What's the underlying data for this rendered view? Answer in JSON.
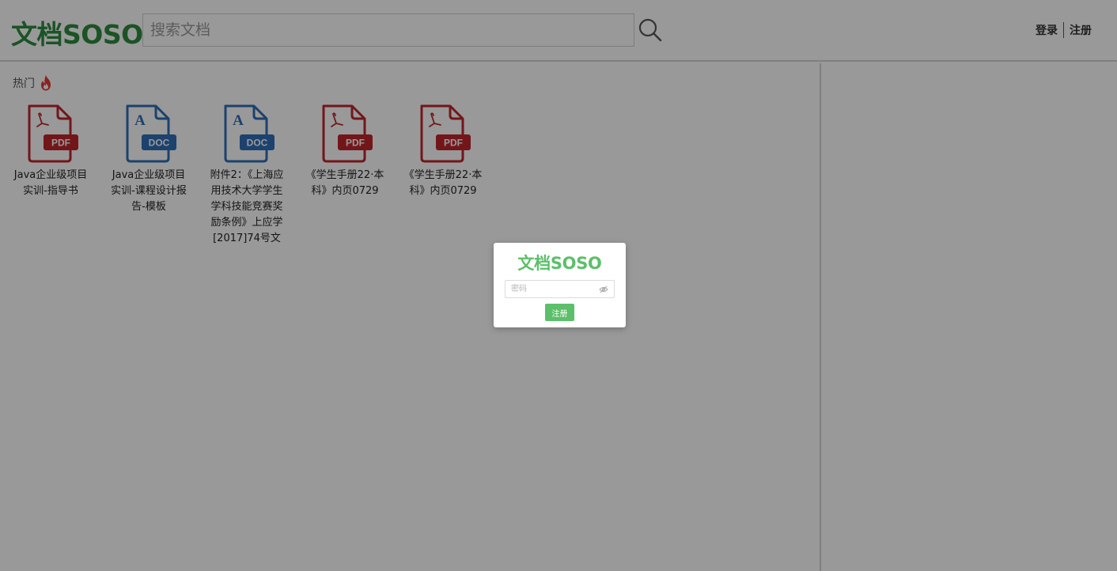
{
  "header": {
    "logo": "文档SOSO",
    "search_placeholder": "搜索文档",
    "login": "登录",
    "register": "注册"
  },
  "hot": {
    "label": "热门"
  },
  "documents": [
    {
      "type": "pdf",
      "badge": "PDF",
      "title": "Java企业级项目实训-指导书"
    },
    {
      "type": "doc",
      "badge": "DOC",
      "title": "Java企业级项目实训-课程设计报告-模板"
    },
    {
      "type": "doc",
      "badge": "DOC",
      "title": "附件2：《上海应用技术大学学生学科技能竞赛奖励条例》上应学[2017]74号文"
    },
    {
      "type": "pdf",
      "badge": "PDF",
      "title": "《学生手册22·本科》内页0729"
    },
    {
      "type": "pdf",
      "badge": "PDF",
      "title": "《学生手册22·本科》内页0729"
    }
  ],
  "modal": {
    "logo": "文档SOSO",
    "password_placeholder": "密码",
    "submit": "注册"
  },
  "colors": {
    "brand_green": "#2e8b3e",
    "modal_green": "#5cbf6a",
    "pdf_red": "#c0262c",
    "doc_blue": "#2f6fb6",
    "hot_icon": "#e53935"
  },
  "icons": {
    "search": "search-icon",
    "hot": "fire-icon",
    "pdf": "pdf-file-icon",
    "doc": "doc-file-icon",
    "eye": "eye-off-icon"
  }
}
